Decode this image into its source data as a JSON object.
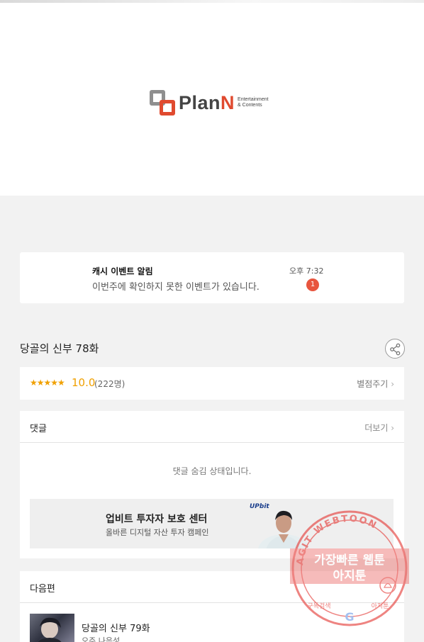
{
  "logo": {
    "word_main": "Plan",
    "word_accent": "N",
    "sub_line1": "Entertainment",
    "sub_line2": "& Contents"
  },
  "notification": {
    "title": "캐시 이벤트 알림",
    "text": "이번주에 확인하지 못한 이벤트가 있습니다.",
    "time": "오후 7:32",
    "badge": "1"
  },
  "episode": {
    "title": "당골의 신부 78화",
    "share_icon": "share-icon"
  },
  "rating": {
    "stars": "★★★★★",
    "score": "10.0",
    "count": "(222명)",
    "rate_link": "별점주기"
  },
  "comments": {
    "title": "댓글",
    "more": "더보기",
    "hidden_message": "댓글 숨김 상태입니다."
  },
  "ad": {
    "title": "업비트 투자자 보호 센터",
    "subtitle": "올바른 디지털 자산 투자 캠페인",
    "brand": "UPbit"
  },
  "next_episode": {
    "section_title": "다음편",
    "title": "당골의 신부 79화",
    "author": "오주,나은성"
  },
  "watermark": {
    "ring_text": "AGIT WEBTOON",
    "line1": "가장빠른 웹툰",
    "line2": "아지툰",
    "bottom_left": "구독검색",
    "bottom_right": "아지툰"
  },
  "colors": {
    "accent": "#e04a2f",
    "star": "#f0a000",
    "badge": "#e8553e",
    "stamp": "#e53935"
  }
}
